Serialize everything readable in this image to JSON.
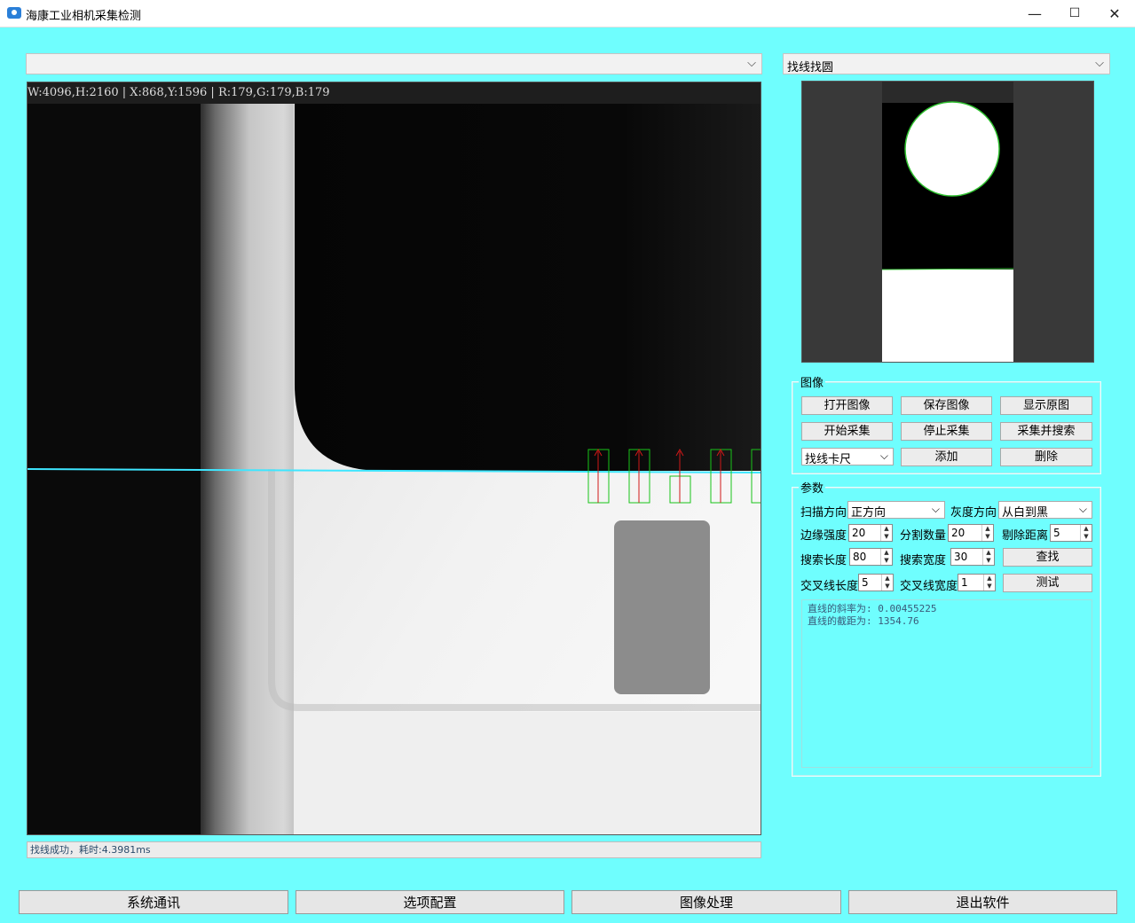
{
  "window": {
    "title": "海康工业相机采集检测",
    "minimize_glyph": "—",
    "maximize_glyph": "☐",
    "close_glyph": "✕"
  },
  "camera_select": {
    "value": ""
  },
  "mode_select": {
    "value": "找线找圆"
  },
  "viewer": {
    "readout": "W:4096,H:2160 | X:868,Y:1596 | R:179,G:179,B:179"
  },
  "status": {
    "text": "找线成功，耗时:4.3981ms"
  },
  "image_group": {
    "title": "图像",
    "buttons": [
      "打开图像",
      "保存图像",
      "显示原图",
      "开始采集",
      "停止采集",
      "采集并搜索"
    ],
    "tool_select": "找线卡尺",
    "add_label": "添加",
    "delete_label": "删除"
  },
  "params_group": {
    "title": "参数",
    "scan_direction_label": "扫描方向",
    "scan_direction_value": "正方向",
    "gray_direction_label": "灰度方向",
    "gray_direction_value": "从白到黑",
    "edge_strength_label": "边缘强度",
    "edge_strength_value": "20",
    "split_count_label": "分割数量",
    "split_count_value": "20",
    "reject_distance_label": "剔除距离",
    "reject_distance_value": "5",
    "search_length_label": "搜索长度",
    "search_length_value": "80",
    "search_width_label": "搜索宽度",
    "search_width_value": "30",
    "find_label": "查找",
    "cross_length_label": "交叉线长度",
    "cross_length_value": "5",
    "cross_width_label": "交叉线宽度",
    "cross_width_value": "1",
    "test_label": "测试",
    "result_lines": [
      "直线的斜率为: 0.00455225",
      "直线的截距为: 1354.76"
    ]
  },
  "tabs": [
    "系统通讯",
    "选项配置",
    "图像处理",
    "退出软件"
  ],
  "colors": {
    "background": "#6ffefe",
    "edge_line": "#3ee6ff",
    "caliper_box": "#19c419",
    "caliper_arrow": "#d01818"
  },
  "icons": {
    "app": "camera-icon",
    "dropdown": "chevron-down-icon"
  }
}
